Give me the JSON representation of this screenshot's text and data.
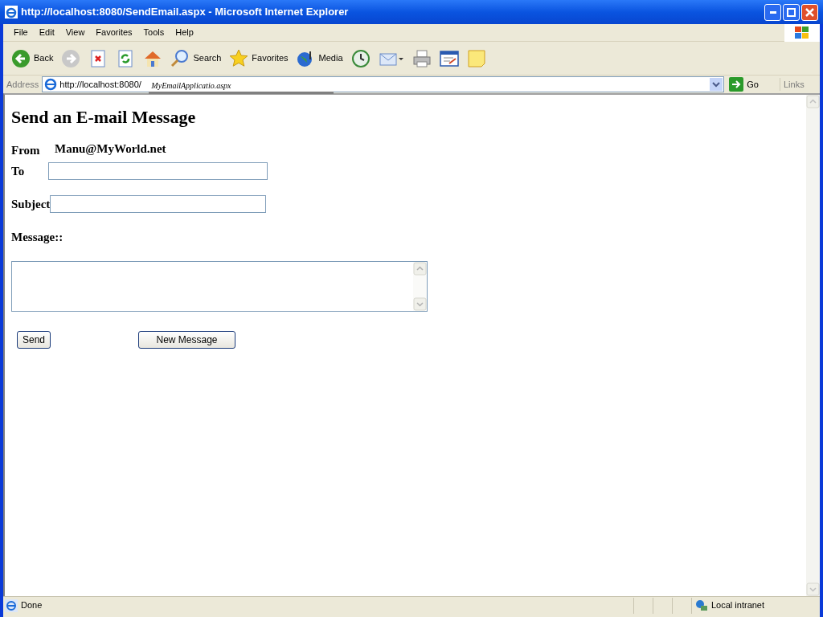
{
  "window": {
    "title": "http://localhost:8080/SendEmail.aspx - Microsoft Internet Explorer"
  },
  "menu": [
    "File",
    "Edit",
    "View",
    "Favorites",
    "Tools",
    "Help"
  ],
  "toolbar": [
    {
      "kind": "back",
      "label": "Back"
    },
    {
      "kind": "forward"
    },
    {
      "kind": "stop"
    },
    {
      "kind": "refresh"
    },
    {
      "kind": "home"
    },
    {
      "kind": "search",
      "label": "Search"
    },
    {
      "kind": "favorites",
      "label": "Favorites"
    },
    {
      "kind": "media",
      "label": "Media"
    },
    {
      "kind": "history"
    },
    {
      "kind": "mail"
    },
    {
      "kind": "print"
    },
    {
      "kind": "edit"
    },
    {
      "kind": "note"
    }
  ],
  "address": {
    "label": "Address",
    "value": "http://localhost:8080/",
    "suggestion": "MyEmailApplicatio.aspx",
    "go": "Go",
    "links": "Links"
  },
  "page": {
    "heading": "Send an E-mail Message",
    "from": {
      "label": "From",
      "value": "Manu@MyWorld.net"
    },
    "to": {
      "label": "To"
    },
    "subject": {
      "label": "Subject"
    },
    "message": {
      "label": "Message::"
    },
    "buttons": [
      "Send",
      "New Message"
    ]
  },
  "status_bar": {
    "text": "Done",
    "zone": "Local intranet"
  }
}
